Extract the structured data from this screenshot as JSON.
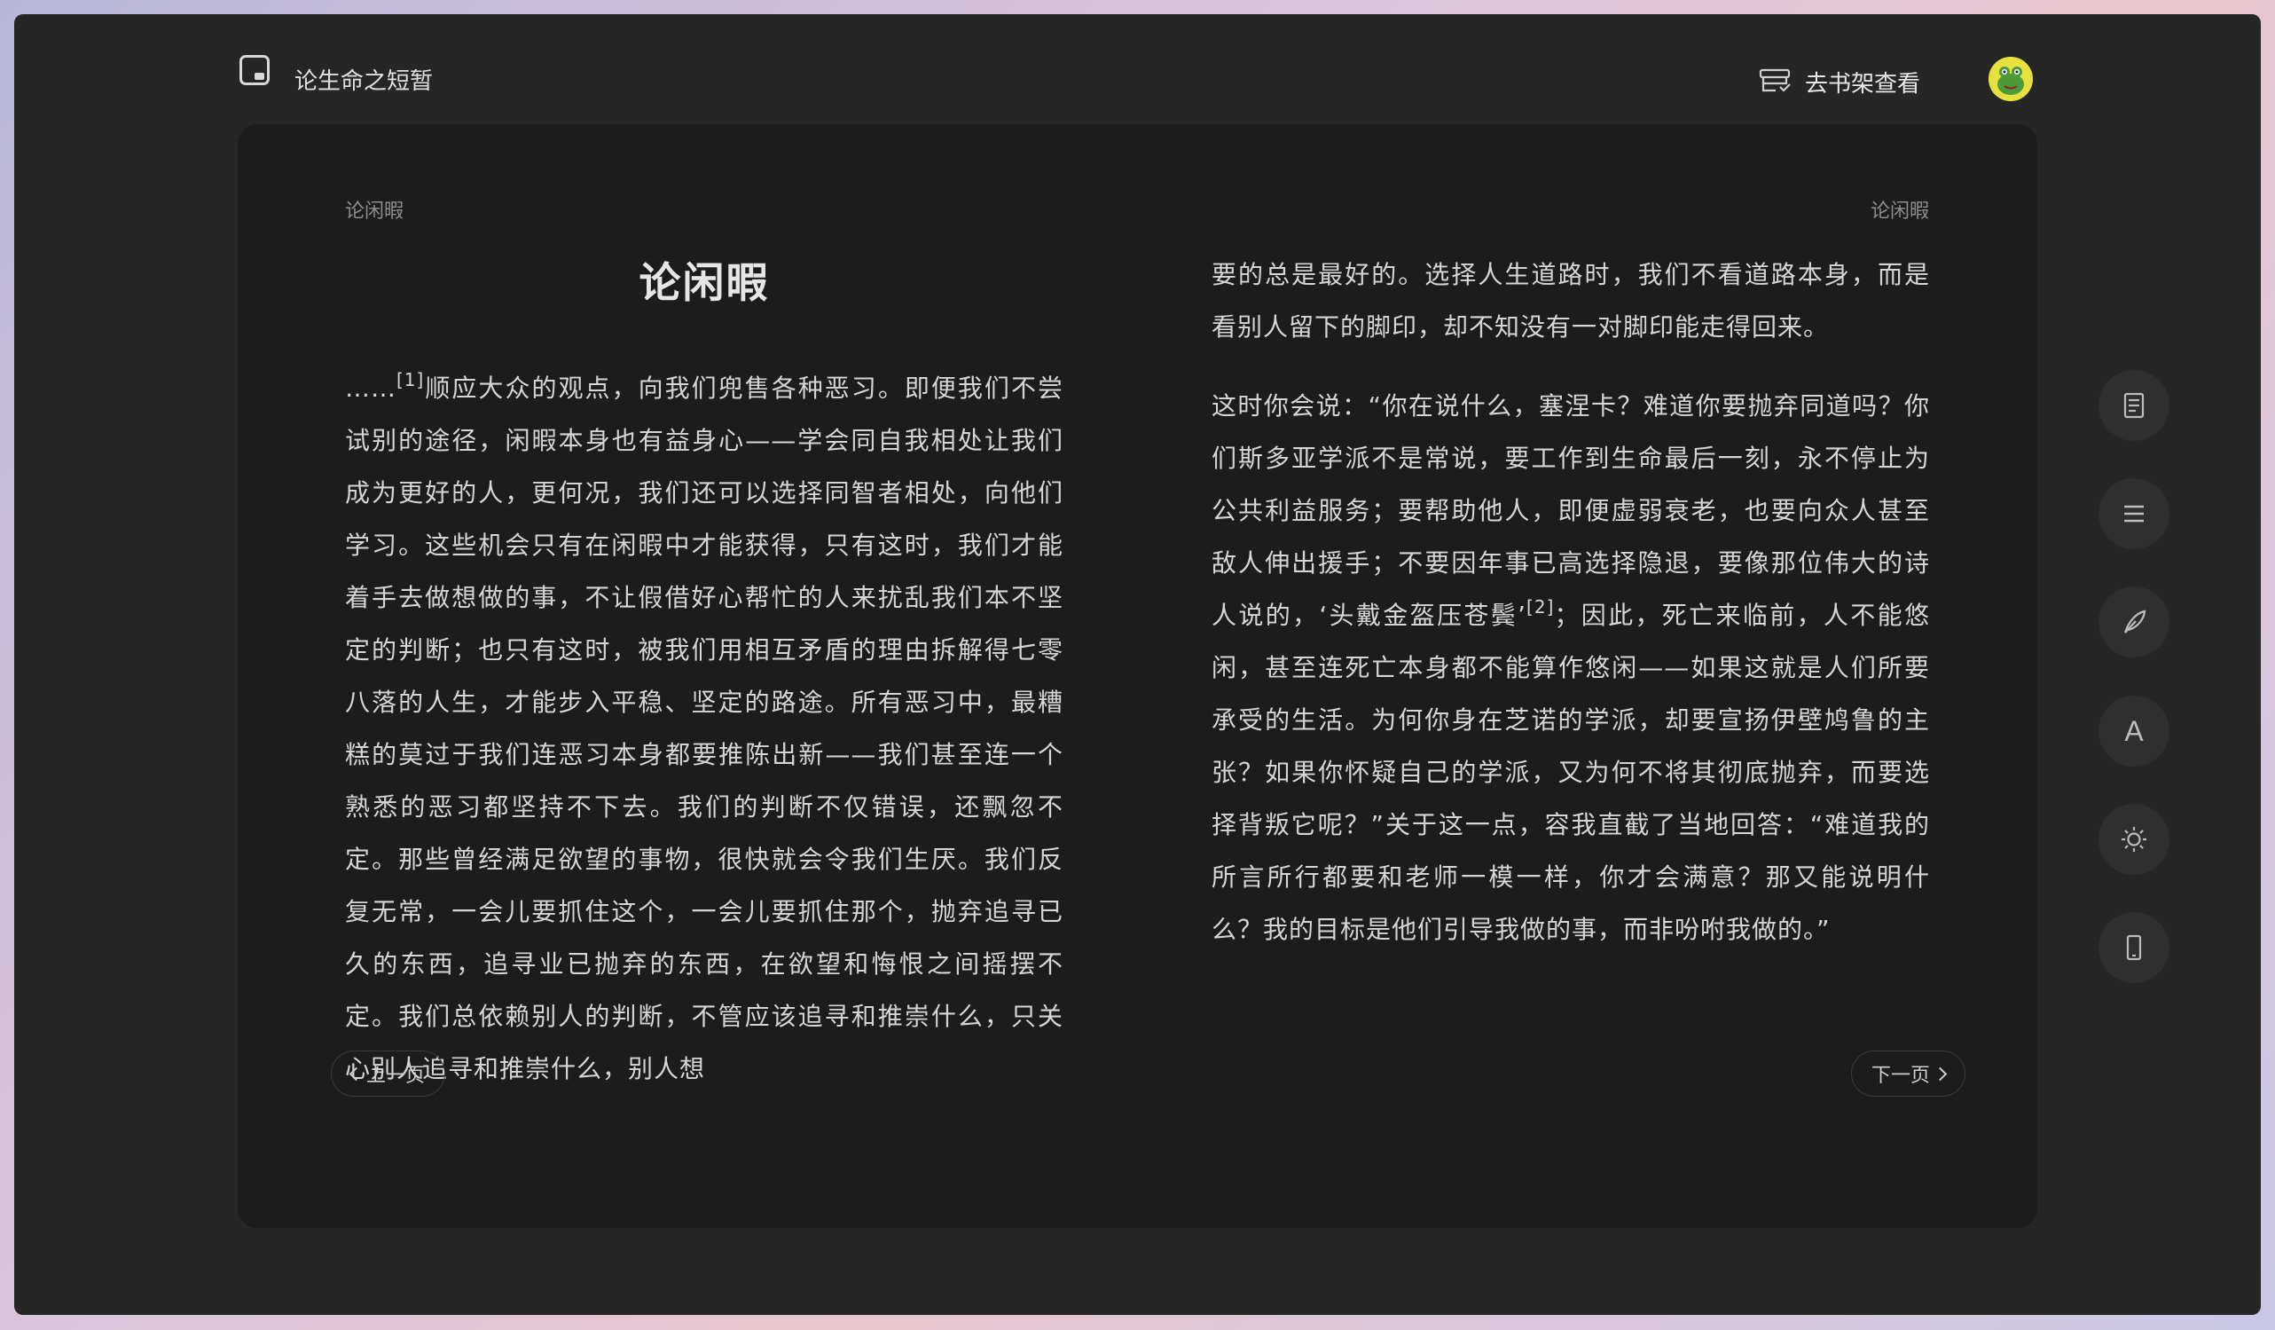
{
  "header": {
    "book_title": "论生命之短暂",
    "shelf_label": "去书架查看"
  },
  "page": {
    "running_head_left": "论闲暇",
    "running_head_right": "论闲暇",
    "chapter_title": "论闲暇",
    "left_text": {
      "lead": "……",
      "footnote_1": "[1]",
      "body": "顺应大众的观点，向我们兜售各种恶习。即便我们不尝试别的途径，闲暇本身也有益身心——学会同自我相处让我们成为更好的人，更何况，我们还可以选择同智者相处，向他们学习。这些机会只有在闲暇中才能获得，只有这时，我们才能着手去做想做的事，不让假借好心帮忙的人来扰乱我们本不坚定的判断；也只有这时，被我们用相互矛盾的理由拆解得七零八落的人生，才能步入平稳、坚定的路途。所有恶习中，最糟糕的莫过于我们连恶习本身都要推陈出新——我们甚至连一个熟悉的恶习都坚持不下去。我们的判断不仅错误，还飘忽不定。那些曾经满足欲望的事物，很快就会令我们生厌。我们反复无常，一会儿要抓住这个，一会儿要抓住那个，抛弃追寻已久的东西，追寻业已抛弃的东西，在欲望和悔恨之间摇摆不定。我们总依赖别人的判断，不管应该追寻和推崇什么，只关心别人追寻和推崇什么，别人想"
    },
    "right_text": {
      "para1": "要的总是最好的。选择人生道路时，我们不看道路本身，而是看别人留下的脚印，却不知没有一对脚印能走得回来。",
      "para2_a": "这时你会说：“你在说什么，塞涅卡？难道你要抛弃同道吗？你们斯多亚学派不是常说，要工作到生命最后一刻，永不停止为公共利益服务；要帮助他人，即便虚弱衰老，也要向众人甚至敌人伸出援手；不要因年事已高选择隐退，要像那位伟大的诗人说的，‘头戴金盔压苍鬓’",
      "footnote_2": "[2]",
      "para2_b": "；因此，死亡来临前，人不能悠闲，甚至连死亡本身都不能算作悠闲——如果这就是人们所要承受的生活。为何你身在芝诺的学派，却要宣扬伊壁鸠鲁的主张？如果你怀疑自己的学派，又为何不将其彻底抛弃，而要选择背叛它呢？”关于这一点，容我直截了当地回答：“难道我的所言所行都要和老师一模一样，你才会满意？那又能说明什么？我的目标是他们引导我做的事，而非吩咐我做的。”"
    },
    "prev_label": "上一页",
    "next_label": "下一页"
  },
  "toolbar": {
    "items": [
      {
        "name": "notes-icon"
      },
      {
        "name": "menu-icon"
      },
      {
        "name": "feather-icon"
      },
      {
        "name": "font-icon",
        "label": "A"
      },
      {
        "name": "brightness-icon"
      },
      {
        "name": "phone-icon"
      }
    ]
  },
  "colors": {
    "window_bg": "#262626",
    "page_bg": "#1c1c1c",
    "text": "#d6d6d6",
    "muted": "#8e8e8e"
  }
}
